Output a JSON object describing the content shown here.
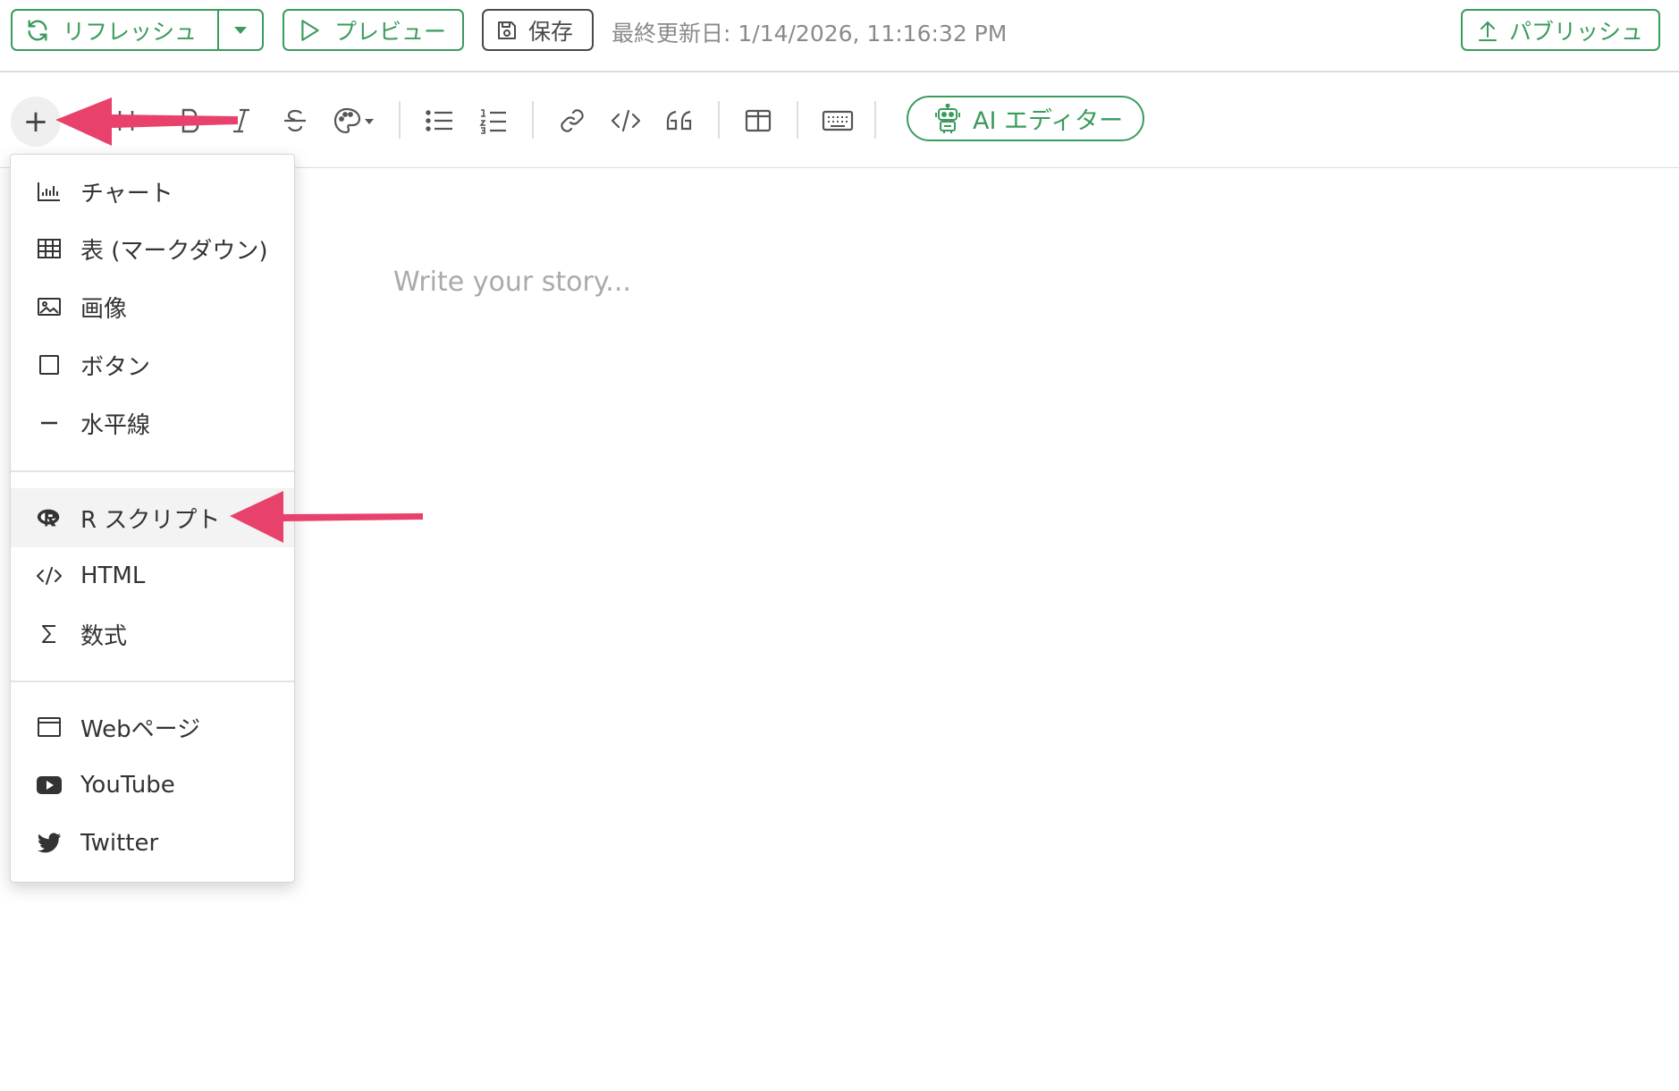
{
  "topbar": {
    "refresh_label": "リフレッシュ",
    "preview_label": "プレビュー",
    "save_label": "保存",
    "last_updated": "最終更新日: 1/14/2026, 11:16:32 PM",
    "publish_label": "パブリッシュ"
  },
  "toolbar": {
    "insert_symbol": "+",
    "ai_editor_label": "AI エディター",
    "tools": [
      "heading-icon",
      "bold-icon",
      "italic-icon",
      "strikethrough-icon",
      "palette-icon",
      "bullet-list-icon",
      "numbered-list-icon",
      "link-icon",
      "code-icon",
      "quote-icon",
      "columns-icon",
      "keyboard-icon"
    ]
  },
  "editor": {
    "placeholder": "Write your story..."
  },
  "menu": {
    "items": [
      {
        "label": "チャート",
        "icon": "chart-icon"
      },
      {
        "label": "表 (マークダウン)",
        "icon": "table-icon"
      },
      {
        "label": "画像",
        "icon": "image-icon"
      },
      {
        "label": "ボタン",
        "icon": "button-icon"
      },
      {
        "label": "水平線",
        "icon": "horizontal-rule-icon"
      },
      {
        "label": "R スクリプト",
        "icon": "r-logo-icon",
        "active": true
      },
      {
        "label": "HTML",
        "icon": "code-icon"
      },
      {
        "label": "数式",
        "icon": "sigma-icon"
      },
      {
        "label": "Webページ",
        "icon": "webpage-icon"
      },
      {
        "label": "YouTube",
        "icon": "youtube-icon"
      },
      {
        "label": "Twitter",
        "icon": "twitter-icon"
      }
    ]
  },
  "colors": {
    "accent": "#3a9b5c",
    "arrow": "#e8416b"
  }
}
